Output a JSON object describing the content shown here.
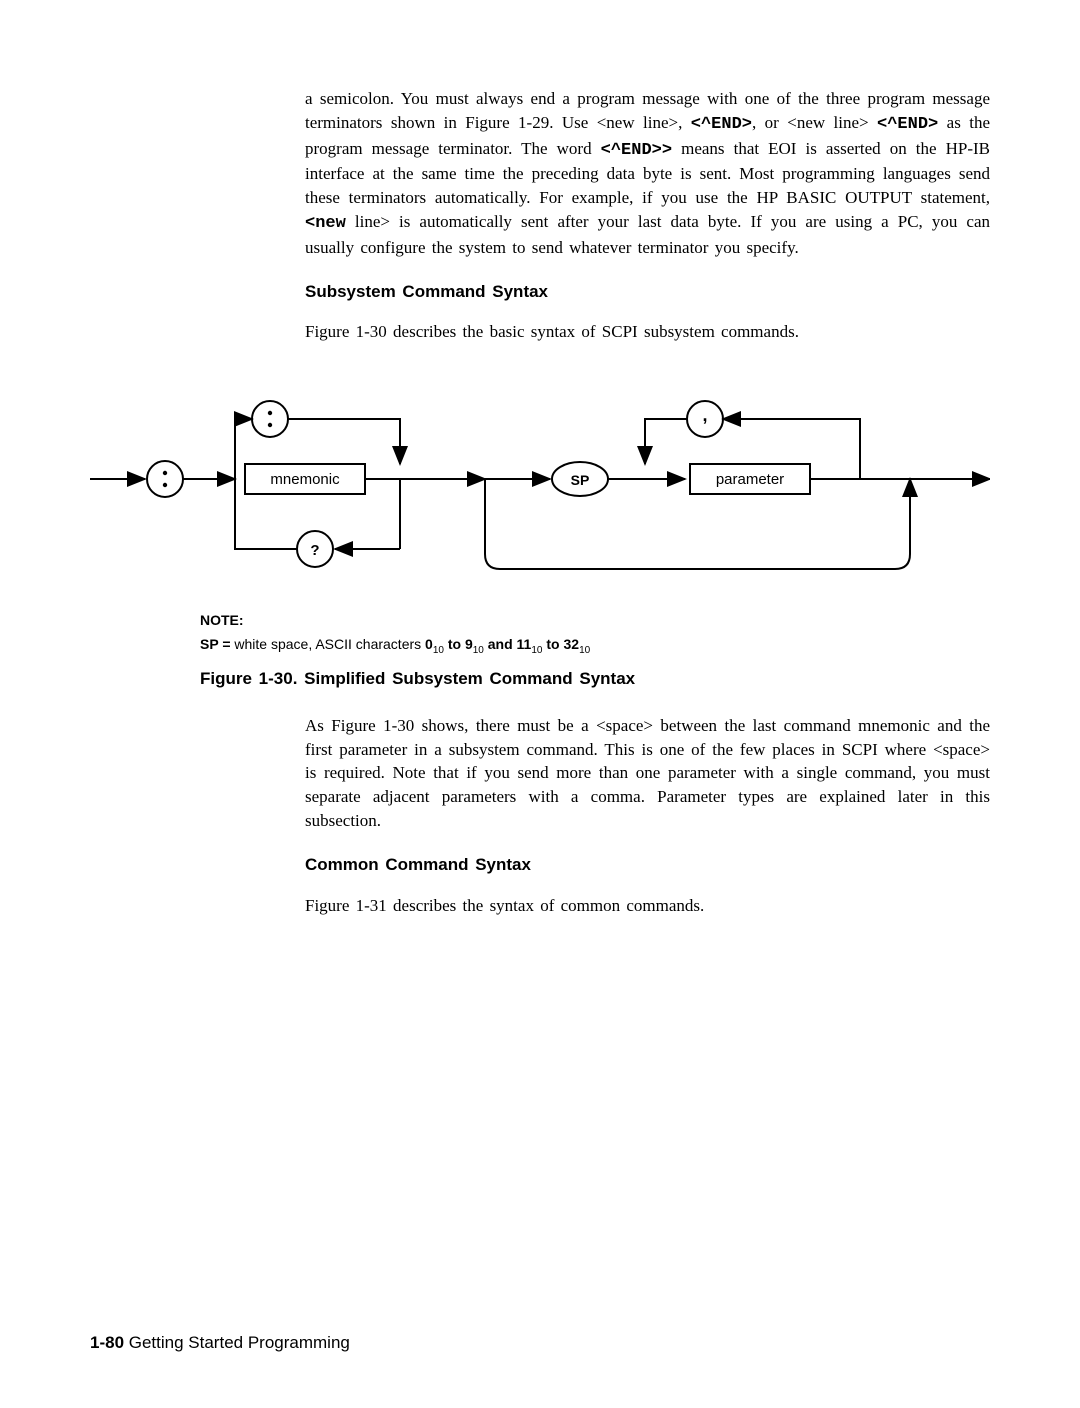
{
  "para1_a": "a semicolon. You must always end a program message with one of the three program message terminators shown in Figure 1-29. Use <new line>, ",
  "para1_b": "<^END>",
  "para1_c": ", or <new line> ",
  "para1_d": "<^END>",
  "para1_e": " as the program message terminator. The word ",
  "para1_f": "<^END>>",
  "para1_g": " means that EOI is asserted on the HP-IB interface at the same time the preceding data byte is sent. Most programming languages send these terminators automatically. For example, if you use the HP BASIC OUTPUT statement, ",
  "para1_h": "<new",
  "para1_i": " line> is automatically sent after your last data byte. If you are using a PC, you can usually configure the system to send whatever terminator you specify.",
  "heading1": "Subsystem Command Syntax",
  "para2": "Figure 1-30 describes the basic syntax of SCPI subsystem commands.",
  "diagram": {
    "mnemonic": "mnemonic",
    "sp": "SP",
    "parameter": "parameter",
    "q": "?",
    "colon": ":",
    "comma": ","
  },
  "note_label": "NOTE:",
  "note_sp": "SP  =",
  "note_text": "  white  space,  ASCII  characters  ",
  "note_v1": "0",
  "note_to1": " to  ",
  "note_v2": "9",
  "note_and": " and  ",
  "note_v3": "11",
  "note_to2": " to  ",
  "note_v4": "32",
  "note_sub": "10",
  "fig_caption": "Figure 1-30. Simplified Subsystem Command Syntax",
  "para3": "As Figure 1-30 shows, there must be a <space> between the last command mnemonic and the first parameter in a subsystem command. This is one of the few places in SCPI where <space> is required. Note that if you send more than one parameter with a single command, you must separate adjacent parameters with a comma. Parameter types are explained later in this subsection.",
  "heading2": "Common Command Syntax",
  "para4": "Figure 1-31 describes the syntax of common commands.",
  "footer_pn": "1-80",
  "footer_title": " Getting Started Programming"
}
